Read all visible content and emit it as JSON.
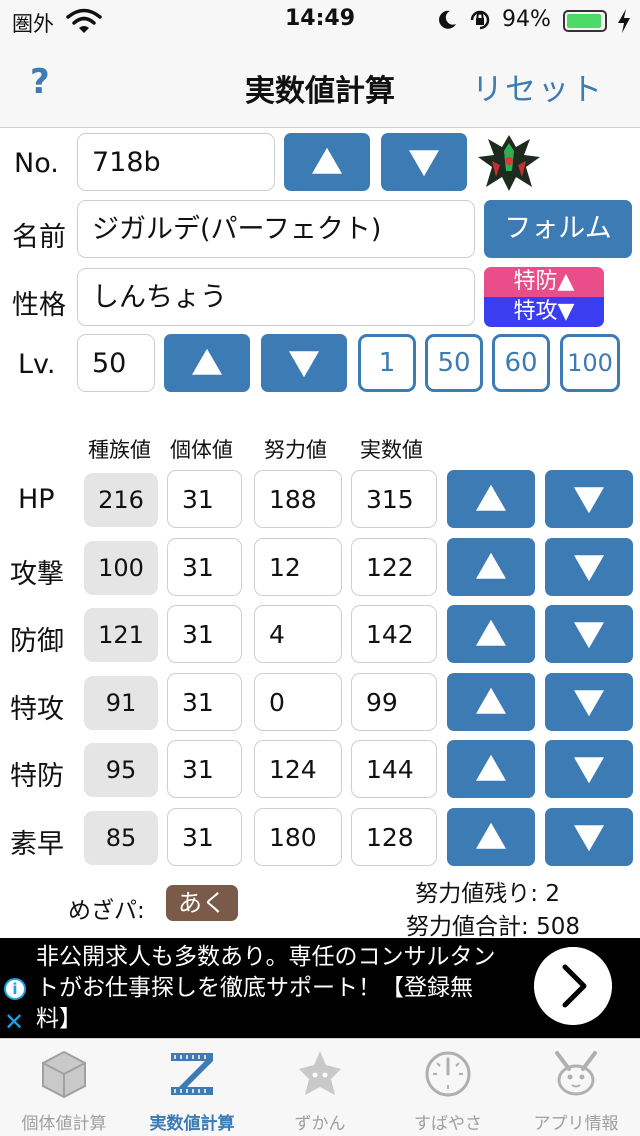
{
  "status": {
    "carrier": "圏外",
    "time": "14:49",
    "battery": "94%",
    "battery_level": 0.94
  },
  "nav": {
    "help": "?",
    "title": "実数値計算",
    "reset": "リセット"
  },
  "form": {
    "no_label": "No.",
    "no_value": "718b",
    "name_label": "名前",
    "name_value": "ジガルデ(パーフェクト)",
    "forme_button": "フォルム",
    "nature_label": "性格",
    "nature_value": "しんちょう",
    "nature_up": "特防▲",
    "nature_down": "特攻▼",
    "level_label": "Lv.",
    "level_value": "50",
    "level_presets": [
      "1",
      "50",
      "60",
      "100"
    ]
  },
  "columns": {
    "base": "種族値",
    "iv": "個体値",
    "ev": "努力値",
    "actual": "実数値"
  },
  "stats": [
    {
      "label": "HP",
      "base": "216",
      "iv": "31",
      "ev": "188",
      "actual": "315"
    },
    {
      "label": "攻撃",
      "base": "100",
      "iv": "31",
      "ev": "12",
      "actual": "122"
    },
    {
      "label": "防御",
      "base": "121",
      "iv": "31",
      "ev": "4",
      "actual": "142"
    },
    {
      "label": "特攻",
      "base": "91",
      "iv": "31",
      "ev": "0",
      "actual": "99"
    },
    {
      "label": "特防",
      "base": "95",
      "iv": "31",
      "ev": "124",
      "actual": "144"
    },
    {
      "label": "素早",
      "base": "85",
      "iv": "31",
      "ev": "180",
      "actual": "128"
    }
  ],
  "hidden_power": {
    "label": "めざパ:",
    "type": "あく",
    "color": "#7a5a48"
  },
  "ev_summary": {
    "remaining": "努力値残り: 2",
    "total": "努力値合計: 508"
  },
  "ad": {
    "text": "非公開求人も多数あり。専任のコンサルタントがお仕事探しを徹底サポート！【登録無料】",
    "info": "i",
    "close": "✕"
  },
  "tabs": [
    {
      "label": "個体値計算",
      "icon": "cube-icon",
      "active": false
    },
    {
      "label": "実数値計算",
      "icon": "z-ruler-icon",
      "active": true
    },
    {
      "label": "ずかん",
      "icon": "monster-icon",
      "active": false
    },
    {
      "label": "すばやさ",
      "icon": "gauge-icon",
      "active": false
    },
    {
      "label": "アプリ情報",
      "icon": "pikachu-icon",
      "active": false
    }
  ],
  "colors": {
    "accent": "#3d7bb5",
    "nature_up": "#e94e8a",
    "nature_down": "#3b3df0",
    "battery": "#4cd964"
  }
}
